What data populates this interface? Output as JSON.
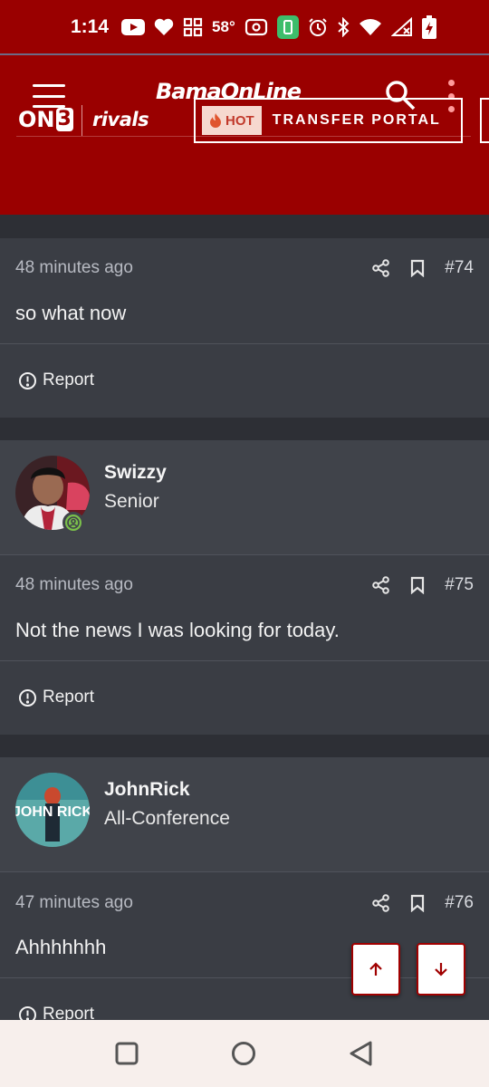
{
  "status_bar": {
    "time": "1:14",
    "temperature": "58°",
    "icons": [
      "youtube-icon",
      "heart-icon",
      "grid-icon",
      "temperature-icon",
      "radio-icon",
      "battery-saver-icon",
      "alarm-icon",
      "bluetooth-icon",
      "wifi-icon",
      "signal-icon",
      "battery-charging-icon"
    ]
  },
  "header": {
    "logo": "BamaOnLine",
    "brand_on3_prefix": "ON",
    "brand_on3_suffix": "3",
    "brand_rivals": "rivals",
    "hot_badge": "HOT",
    "transfer_portal": "TRANSFER PORTAL",
    "accent": "#9a0000"
  },
  "posts": [
    {
      "time": "48 minutes ago",
      "number": "#74",
      "text": "so what now",
      "report": "Report"
    },
    {
      "user": "Swizzy",
      "rank": "Senior",
      "time": "48 minutes ago",
      "number": "#75",
      "text": "Not the news I was looking for today.",
      "report": "Report"
    },
    {
      "user": "JohnRick",
      "rank": "All-Conference",
      "avatar_text": "JOHN RICK",
      "time": "47 minutes ago",
      "number": "#76",
      "text": "Ahhhhhhh",
      "report": "Report"
    }
  ],
  "colors": {
    "page": "#2b2d33",
    "post": "#3a3d44",
    "user": "#40434a",
    "online": "#7bc04b"
  }
}
